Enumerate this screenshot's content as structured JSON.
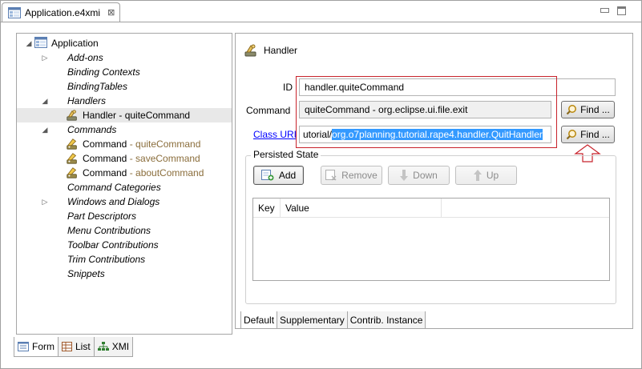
{
  "editor": {
    "tab_title": "Application.e4xmi",
    "close_glyph": "⊠"
  },
  "tree": {
    "items": [
      {
        "label": "Application",
        "style": "normal",
        "toggle": "expanded"
      },
      {
        "label": "Add-ons",
        "style": "italic",
        "toggle": "collapsed"
      },
      {
        "label": "Binding Contexts",
        "style": "italic",
        "toggle": "none"
      },
      {
        "label": "BindingTables",
        "style": "italic",
        "toggle": "none"
      },
      {
        "label": "Handlers",
        "style": "italic",
        "toggle": "expanded"
      },
      {
        "label": "Handler - quiteCommand",
        "style": "normal",
        "toggle": "none"
      },
      {
        "label": "Commands",
        "style": "italic",
        "toggle": "expanded"
      },
      {
        "label": "Command",
        "suffix": " - quiteCommand",
        "style": "normal",
        "toggle": "none"
      },
      {
        "label": "Command",
        "suffix": " - saveCommand",
        "style": "normal",
        "toggle": "none"
      },
      {
        "label": "Command",
        "suffix": " - aboutCommand",
        "style": "normal",
        "toggle": "none"
      },
      {
        "label": "Command Categories",
        "style": "italic",
        "toggle": "none"
      },
      {
        "label": "Windows and Dialogs",
        "style": "italic",
        "toggle": "collapsed"
      },
      {
        "label": "Part Descriptors",
        "style": "italic",
        "toggle": "none"
      },
      {
        "label": "Menu Contributions",
        "style": "italic",
        "toggle": "none"
      },
      {
        "label": "Toolbar Contributions",
        "style": "italic",
        "toggle": "none"
      },
      {
        "label": "Trim Contributions",
        "style": "italic",
        "toggle": "none"
      },
      {
        "label": "Snippets",
        "style": "italic",
        "toggle": "none"
      }
    ],
    "selected_index": 5
  },
  "bottom_tabs": [
    {
      "label": "Form",
      "icon": "form-icon"
    },
    {
      "label": "List",
      "icon": "list-icon"
    },
    {
      "label": "XMI",
      "icon": "xmi-tree-icon"
    }
  ],
  "details": {
    "title": "Handler",
    "id_label": "ID",
    "id_value": "handler.quiteCommand",
    "command_label": "Command",
    "command_value": "quiteCommand - org.eclipse.ui.file.exit",
    "class_uri_label": "Class URI",
    "class_uri_prefix": "utorial/",
    "class_uri_selected": "org.o7planning.tutorial.rape4.handler.QuitHandler",
    "find_label": "Find ...",
    "persisted_state_title": "Persisted State",
    "buttons": {
      "add": "Add",
      "remove": "Remove",
      "down": "Down",
      "up": "Up"
    },
    "table_columns": [
      "Key",
      "Value"
    ]
  },
  "detail_tabs": [
    "Default",
    "Supplementary",
    "Contrib. Instance"
  ],
  "colors": {
    "highlight_box": "#c8232c",
    "selection": "#3399ff",
    "link": "#0000ff"
  }
}
